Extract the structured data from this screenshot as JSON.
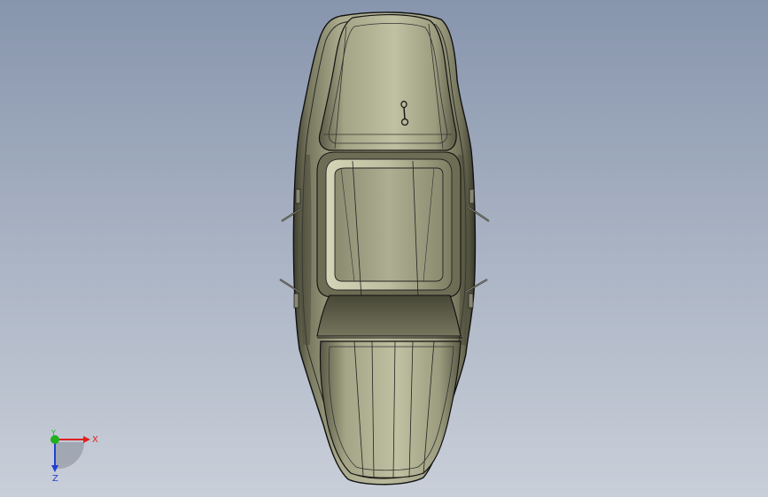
{
  "viewport": {
    "background_top": "#8795ad",
    "background_bottom": "#c9cfd9"
  },
  "model": {
    "part": "seat-shell",
    "fill": "#8a8a6e",
    "edge_color": "#151515"
  },
  "triad": {
    "x_label": "X",
    "y_label": "Y",
    "z_label": "Z",
    "x_color": "#e02020",
    "y_color": "#20b020",
    "z_color": "#2040d0"
  }
}
